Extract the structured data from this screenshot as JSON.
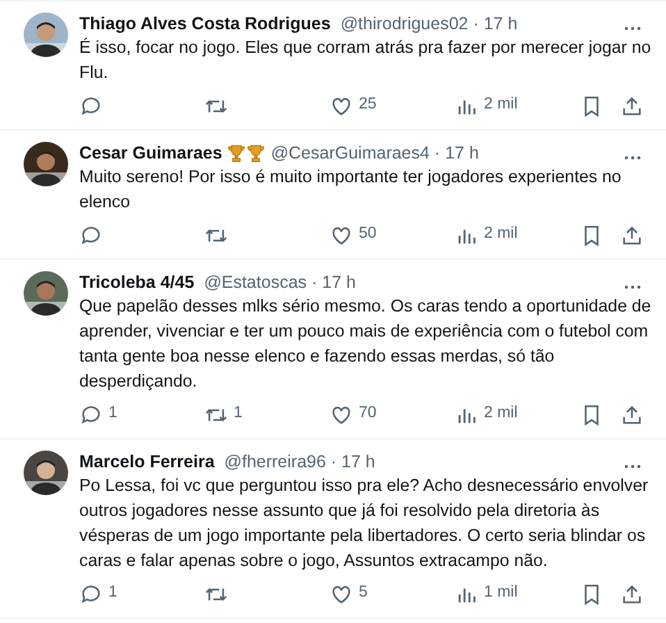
{
  "tweets": [
    {
      "name": "Thiago Alves Costa Rodrigues",
      "meta": "@thirodrigues02 · 17 h",
      "text": "É isso, focar no jogo. Eles que corram atrás pra fazer por merecer jogar no Flu.",
      "likes": "25",
      "views": "2 mil"
    },
    {
      "name": "Cesar Guimaraes",
      "badges": [
        {
          "kind": "trophy"
        },
        {
          "kind": "trophy"
        }
      ],
      "meta": "@CesarGuimaraes4 · 17 h",
      "text": "Muito sereno! Por isso é muito importante ter jogadores experientes no elenco",
      "likes": "50",
      "views": "2 mil"
    },
    {
      "name": "Tricoleba 4/45",
      "meta": "@Estatoscas · 17 h",
      "text": "Que papelão desses mlks sério mesmo. Os caras tendo a oportunidade de aprender, vivenciar e ter um pouco mais de experiência com o futebol com tanta gente boa nesse elenco e fazendo essas merdas, só tão desperdiçando.",
      "replies": "1",
      "retweets": "1",
      "likes": "70",
      "views": "2 mil"
    },
    {
      "name": "Marcelo Ferreira",
      "meta": "@fherreira96 · 17 h",
      "text": "Po Lessa, foi vc que perguntou isso pra ele? Acho desnecessário envolver outros jogadores nesse assunto que já foi resolvido pela diretoria às vésperas de um jogo importante pela libertadores. O certo seria blindar os caras e falar apenas sobre o jogo, Assuntos extracampo não.",
      "replies": "1",
      "likes": "5",
      "views": "1 mil"
    }
  ]
}
